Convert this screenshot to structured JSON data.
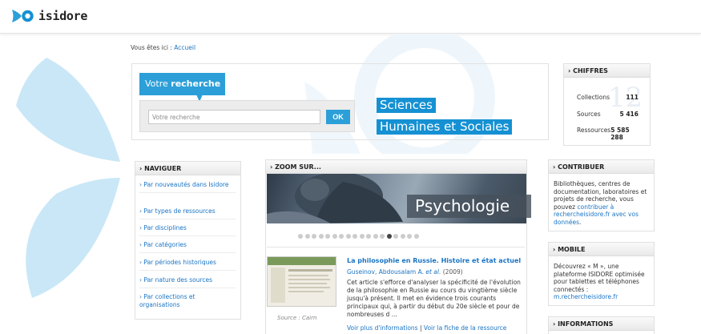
{
  "header": {
    "logo_text": "isidore"
  },
  "breadcrumb": {
    "prefix": "Vous êtes ici :",
    "link": "Accueil"
  },
  "search": {
    "badge_regular": "Votre ",
    "badge_bold": "recherche",
    "placeholder": "Votre recherche",
    "button": "OK"
  },
  "tagline": {
    "line1": "Sciences",
    "line2": "Humaines et Sociales"
  },
  "chiffres": {
    "title": "› CHIFFRES",
    "rows": [
      {
        "label": "Collections",
        "value": "111"
      },
      {
        "label": "Sources",
        "value": "5 416"
      },
      {
        "label": "Ressources",
        "value": "5 585 288"
      }
    ]
  },
  "naviguer": {
    "title": "› NAVIGUER",
    "items": [
      "› Par nouveautés dans Isidore",
      "› Par types de ressources",
      "› Par disciplines",
      "› Par catégories",
      "› Par périodes historiques",
      "› Par nature des sources",
      "› Par collections et organisations"
    ]
  },
  "zoom": {
    "title": "› ZOOM SUR...",
    "hero_label": "Psychologie",
    "dots_count": 18,
    "active_dot": 13
  },
  "article": {
    "title": "La philosophie en Russie. Histoire et état actuel",
    "authors": "Guseinov, Abdousalam A.",
    "etal": " et al.",
    "year": " (2009)",
    "summary": "Cet article s'efforce d'analyser la spécificité de l'évolution de la philosophie en Russie au cours du vingtième siècle jusqu'à présent. Il met en évidence trois courants principaux qui, à partir du début du 20e siècle et pour de nombreuses d ...",
    "source": "Source : Cairn",
    "more": "Voir plus d'informations",
    "sep": " | ",
    "sheet": "Voir la fiche de la ressource"
  },
  "contribuer": {
    "title": "› CONTRIBUER",
    "text": "Bibliothèques, centres de documentation, laboratoires et projets de recherche, vous pouvez ",
    "link": "contribuer à rechercheisidore.fr avec vos données",
    "end": "."
  },
  "mobile": {
    "title": "› MOBILE",
    "text": "Découvrez « M », une plateforme ISIDORE optimisée pour tablettes et téléphones connectés :",
    "link": "m.rechercheisidore.fr"
  },
  "informations": {
    "title": "› INFORMATIONS"
  },
  "colors": {
    "brand_blue": "#2c9fd9",
    "tag_blue": "#1591d3",
    "link": "#1a74c4",
    "deco": "#c9e7f7"
  }
}
